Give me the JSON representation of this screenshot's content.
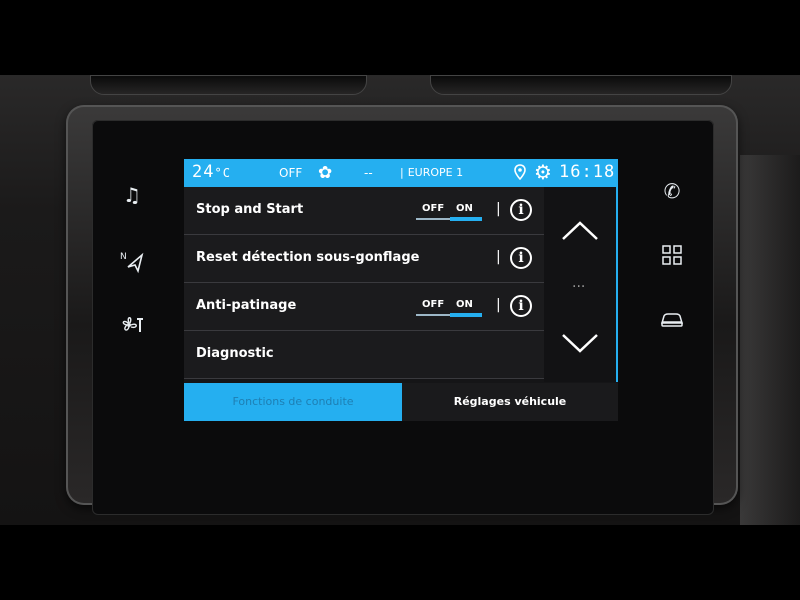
{
  "status": {
    "temperature_value": "24",
    "temperature_unit": "°C",
    "fan_state": "OFF",
    "fan_icon": "fan-icon",
    "fan_dashes": "--",
    "radio_station": "EUROPE 1",
    "clock": "16:18",
    "accent_color": "#25aff0"
  },
  "side_left": {
    "icons": [
      "music-note-icon",
      "navigation-arrow-icon",
      "climate-fan-icon"
    ]
  },
  "side_right": {
    "icons": [
      "phone-icon",
      "apps-grid-icon",
      "car-icon"
    ]
  },
  "settings": {
    "rows": [
      {
        "label": "Stop and Start",
        "off_label": "OFF",
        "on_label": "ON",
        "state": "ON",
        "info": "i"
      },
      {
        "label": "Reset détection sous-gonflage",
        "info": "i"
      },
      {
        "label": "Anti-patinage",
        "off_label": "OFF",
        "on_label": "ON",
        "state": "ON",
        "info": "i"
      },
      {
        "label": "Diagnostic"
      }
    ],
    "separator": "|",
    "scroll_dots": "···"
  },
  "tabs": [
    {
      "label": "Fonctions de conduite",
      "active": true
    },
    {
      "label": "Réglages véhicule",
      "active": false
    }
  ]
}
